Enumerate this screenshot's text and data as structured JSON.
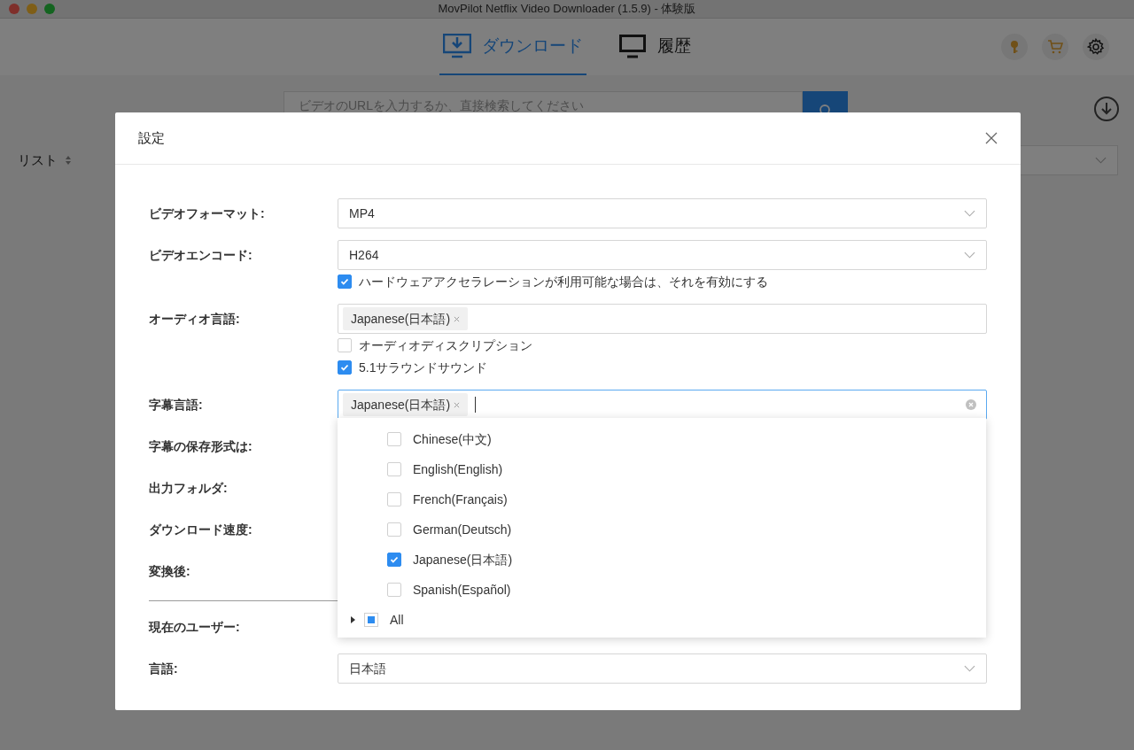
{
  "window": {
    "title": "MovPilot Netflix Video Downloader (1.5.9) - 体験版"
  },
  "tabs": [
    {
      "label": "ダウンロード",
      "selected": true
    },
    {
      "label": "履歴",
      "selected": false
    }
  ],
  "search": {
    "placeholder": "ビデオのURLを入力するか、直接検索してください"
  },
  "list_header": {
    "label": "リスト"
  },
  "dialog": {
    "title": "設定",
    "rows": [
      {
        "kind": "select",
        "label": "ビデオフォーマット:",
        "value": "MP4"
      },
      {
        "kind": "select",
        "label": "ビデオエンコード:",
        "value": "H264",
        "options": [
          {
            "label": "ハードウェアアクセラレーションが利用可能な場合は、それを有効にする",
            "checked": true
          }
        ]
      },
      {
        "kind": "tags",
        "label": "オーディオ言語:",
        "tags": [
          "Japanese(日本語)"
        ],
        "focused": false,
        "options": [
          {
            "label": "オーディオディスクリプション",
            "checked": false
          },
          {
            "label": "5.1サラウンドサウンド",
            "checked": true
          }
        ]
      },
      {
        "kind": "tags",
        "label": "字幕言語:",
        "tags": [
          "Japanese(日本語)"
        ],
        "focused": true
      },
      {
        "kind": "label",
        "label": "字幕の保存形式は:"
      },
      {
        "kind": "label",
        "label": "出力フォルダ:"
      },
      {
        "kind": "label",
        "label": "ダウンロード速度:"
      },
      {
        "kind": "label",
        "label": "変換後:"
      },
      {
        "kind": "divider"
      },
      {
        "kind": "label",
        "label": "現在のユーザー:"
      },
      {
        "kind": "select",
        "label": "言語:",
        "value": "日本語"
      }
    ]
  },
  "subtitle_dropdown": {
    "items": [
      {
        "label": "Chinese(中文)",
        "checked": false
      },
      {
        "label": "English(English)",
        "checked": false
      },
      {
        "label": "French(Français)",
        "checked": false
      },
      {
        "label": "German(Deutsch)",
        "checked": false
      },
      {
        "label": "Japanese(日本語)",
        "checked": true
      },
      {
        "label": "Spanish(Español)",
        "checked": false
      }
    ],
    "all": {
      "label": "All",
      "indeterminate": true,
      "expanded": false
    }
  }
}
